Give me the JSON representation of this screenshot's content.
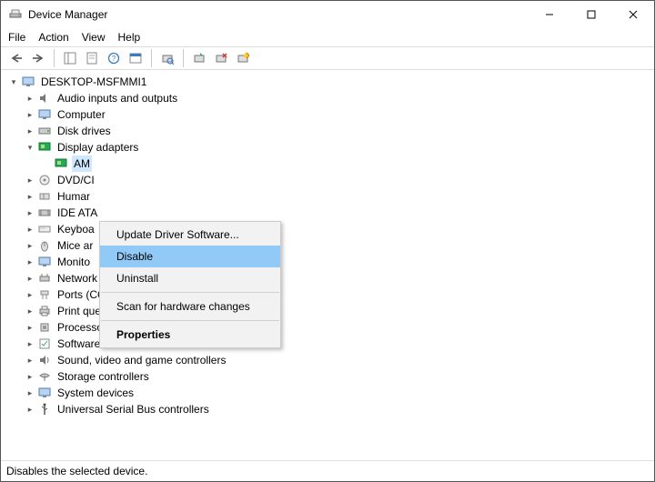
{
  "window": {
    "title": "Device Manager"
  },
  "menubar": [
    "File",
    "Action",
    "View",
    "Help"
  ],
  "tree": {
    "root": "DESKTOP-MSFMMI1",
    "selected_device": "AM",
    "categories": [
      "Audio inputs and outputs",
      "Computer",
      "Disk drives",
      "Display adapters",
      "DVD/CI",
      "Humar",
      "IDE ATA",
      "Keyboa",
      "Mice ar",
      "Monito",
      "Network adapters",
      "Ports (COM & LPT)",
      "Print queues",
      "Processors",
      "Software devices",
      "Sound, video and game controllers",
      "Storage controllers",
      "System devices",
      "Universal Serial Bus controllers"
    ]
  },
  "context_menu": {
    "update": "Update Driver Software...",
    "disable": "Disable",
    "uninstall": "Uninstall",
    "scan": "Scan for hardware changes",
    "properties": "Properties"
  },
  "statusbar": "Disables the selected device."
}
